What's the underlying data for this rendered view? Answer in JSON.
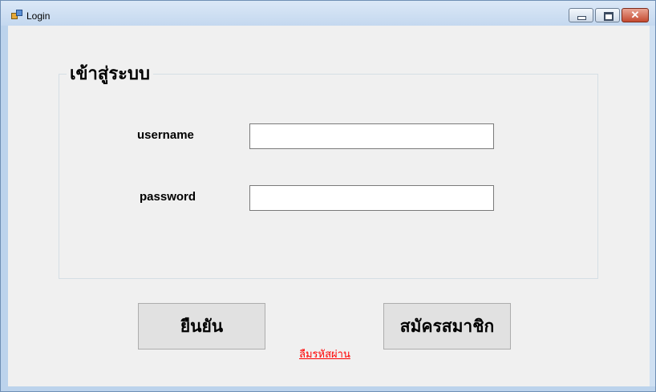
{
  "window": {
    "title": "Login",
    "icon": "form-icon",
    "controls": {
      "minimize": "minimize-icon",
      "maximize": "maximize-icon",
      "close": "✕"
    }
  },
  "form": {
    "group_title": "เข้าสู่ระบบ",
    "username_label": "username",
    "username_value": "",
    "password_label": "password",
    "password_value": ""
  },
  "actions": {
    "confirm_label": "ยืนยัน",
    "register_label": "สมัครสมาชิก",
    "forgot_password_link": "ลืมรหัสผ่าน"
  },
  "colors": {
    "link": "#ff0000",
    "button_bg": "#e1e1e1",
    "form_bg": "#f0f0f0"
  }
}
